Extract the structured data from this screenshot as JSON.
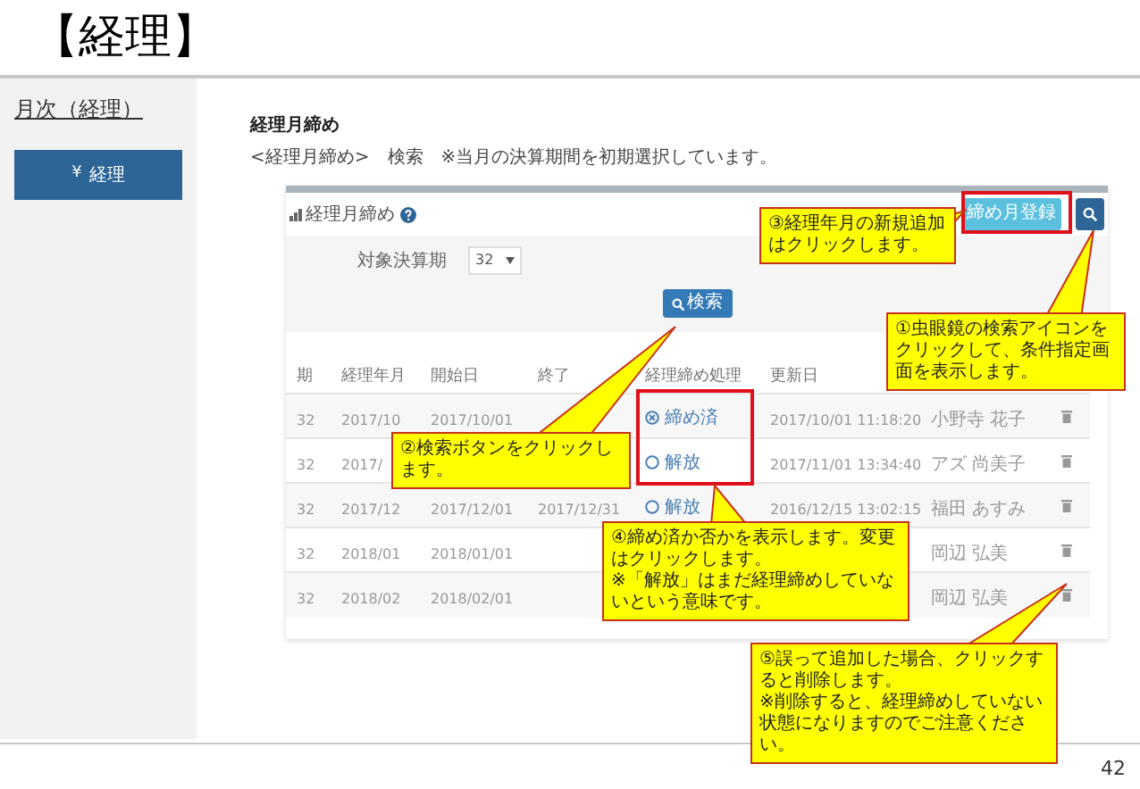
{
  "slide": {
    "title": "【経理】",
    "page_number": "42"
  },
  "sidebar": {
    "heading": "月次（経理）",
    "items": [
      {
        "icon": "¥",
        "label": "経理",
        "selected": true
      }
    ]
  },
  "page": {
    "title": "経理月締め",
    "breadcrumb": "<経理月締め>　検索　※当月の決算期間を初期選択しています。"
  },
  "panel": {
    "title": "経理月締め",
    "add_button": "締め月登録",
    "filter": {
      "label": "対象決算期",
      "value": "32"
    },
    "search_button": "検索"
  },
  "table": {
    "columns": [
      "期",
      "経理年月",
      "開始日",
      "終了",
      "経理締め処理",
      "更新日"
    ],
    "rows": [
      {
        "term": "32",
        "month": "2017/10",
        "start": "2017/10/01",
        "status": "締め済",
        "closed": true,
        "updated": "2017/10/01 11:18:20",
        "user": "小野寺 花子"
      },
      {
        "term": "32",
        "month": "2017/",
        "status": "解放",
        "closed": false,
        "updated": "2017/11/01 13:34:40",
        "user": "アズ 尚美子"
      },
      {
        "term": "32",
        "month": "2017/12",
        "start": "2017/12/01",
        "end": "2017/12/31",
        "status": "解放",
        "closed": false,
        "updated": "2016/12/15 13:02:15",
        "user": "福田 あすみ"
      },
      {
        "term": "32",
        "month": "2018/01",
        "start": "2018/01/01",
        "user": "岡辺 弘美"
      },
      {
        "term": "32",
        "month": "2018/02",
        "start": "2018/02/01",
        "user": "岡辺 弘美"
      }
    ]
  },
  "callouts": [
    {
      "text": "③経理年月の新規追加はクリックします。"
    },
    {
      "text": "①虫眼鏡の検索アイコンをクリックして、条件指定画面を表示します。"
    },
    {
      "text": "②検索ボタンをクリックします。"
    },
    {
      "text": "④締め済か否かを表示します。変更はクリックします。\n※「解放」はまだ経理締めしていないという意味です。"
    },
    {
      "text": "⑤誤って追加した場合、クリックすると削除します。\n※削除すると、経理締めしていない状態になりますのでご注意ください。"
    }
  ]
}
